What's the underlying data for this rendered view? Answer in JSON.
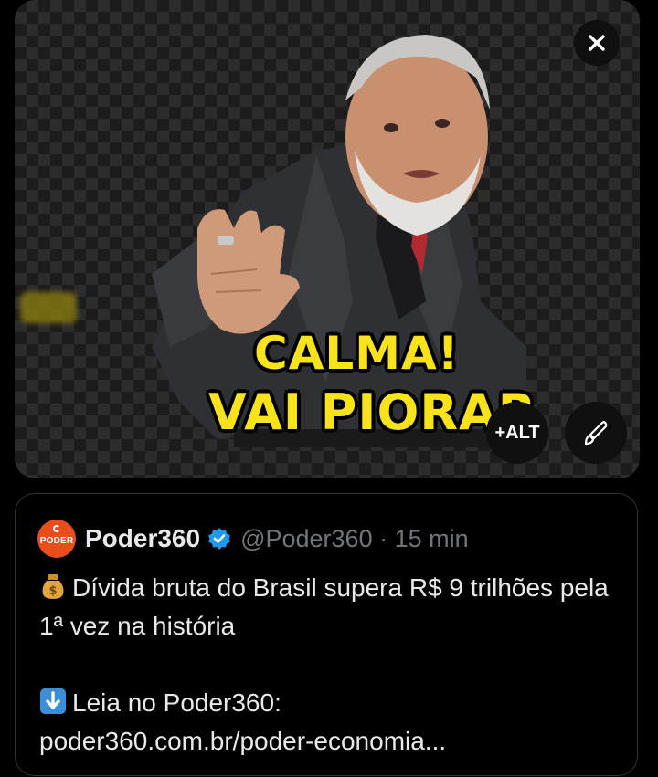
{
  "media": {
    "caption_line1": "CALMA!",
    "caption_line2": "VAI PIORAR",
    "close_icon": "close-icon",
    "alt_label": "+ALT",
    "edit_icon": "brush-icon"
  },
  "quote": {
    "avatar_text": "PODER",
    "name": "Poder360",
    "handle_time": "@Poder360 · 15 min",
    "line1": "Dívida bruta do Brasil supera R$ 9 trilhões pela 1ª vez na história",
    "line2": "Leia no Poder360:",
    "link": "poder360.com.br/poder-economia..."
  },
  "colors": {
    "caption": "#f7e21b",
    "verified": "#1d9bf0",
    "avatar": "#e84e1b"
  }
}
